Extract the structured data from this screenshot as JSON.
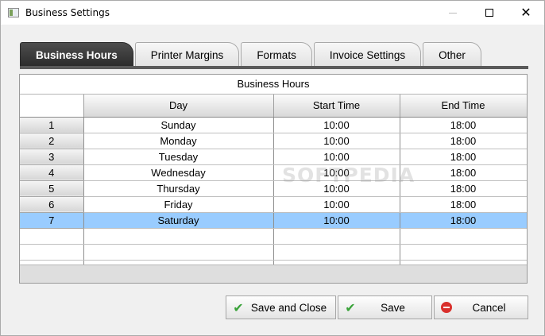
{
  "window": {
    "title": "Business Settings"
  },
  "tabs": [
    {
      "label": "Business Hours",
      "active": true
    },
    {
      "label": "Printer Margins",
      "active": false
    },
    {
      "label": "Formats",
      "active": false
    },
    {
      "label": "Invoice Settings",
      "active": false
    },
    {
      "label": "Other",
      "active": false
    }
  ],
  "grid": {
    "caption": "Business Hours",
    "watermark": "SOFTPEDIA",
    "columns": [
      "Day",
      "Start Time",
      "End Time"
    ],
    "rows": [
      {
        "num": "1",
        "day": "Sunday",
        "start": "10:00",
        "end": "18:00"
      },
      {
        "num": "2",
        "day": "Monday",
        "start": "10:00",
        "end": "18:00"
      },
      {
        "num": "3",
        "day": "Tuesday",
        "start": "10:00",
        "end": "18:00"
      },
      {
        "num": "4",
        "day": "Wednesday",
        "start": "10:00",
        "end": "18:00"
      },
      {
        "num": "5",
        "day": "Thursday",
        "start": "10:00",
        "end": "18:00"
      },
      {
        "num": "6",
        "day": "Friday",
        "start": "10:00",
        "end": "18:00"
      },
      {
        "num": "7",
        "day": "Saturday",
        "start": "10:00",
        "end": "18:00"
      }
    ],
    "selected_row": "7",
    "selection_color": "#99ccff"
  },
  "buttons": {
    "save_close": {
      "label": "Save and Close",
      "icon": "check-icon"
    },
    "save": {
      "label": "Save",
      "icon": "check-icon"
    },
    "cancel": {
      "label": "Cancel",
      "icon": "cancel-icon"
    }
  },
  "colors": {
    "active_tab": "#2b2b2b",
    "check": "#3aa33a",
    "cancel": "#d9302c"
  }
}
